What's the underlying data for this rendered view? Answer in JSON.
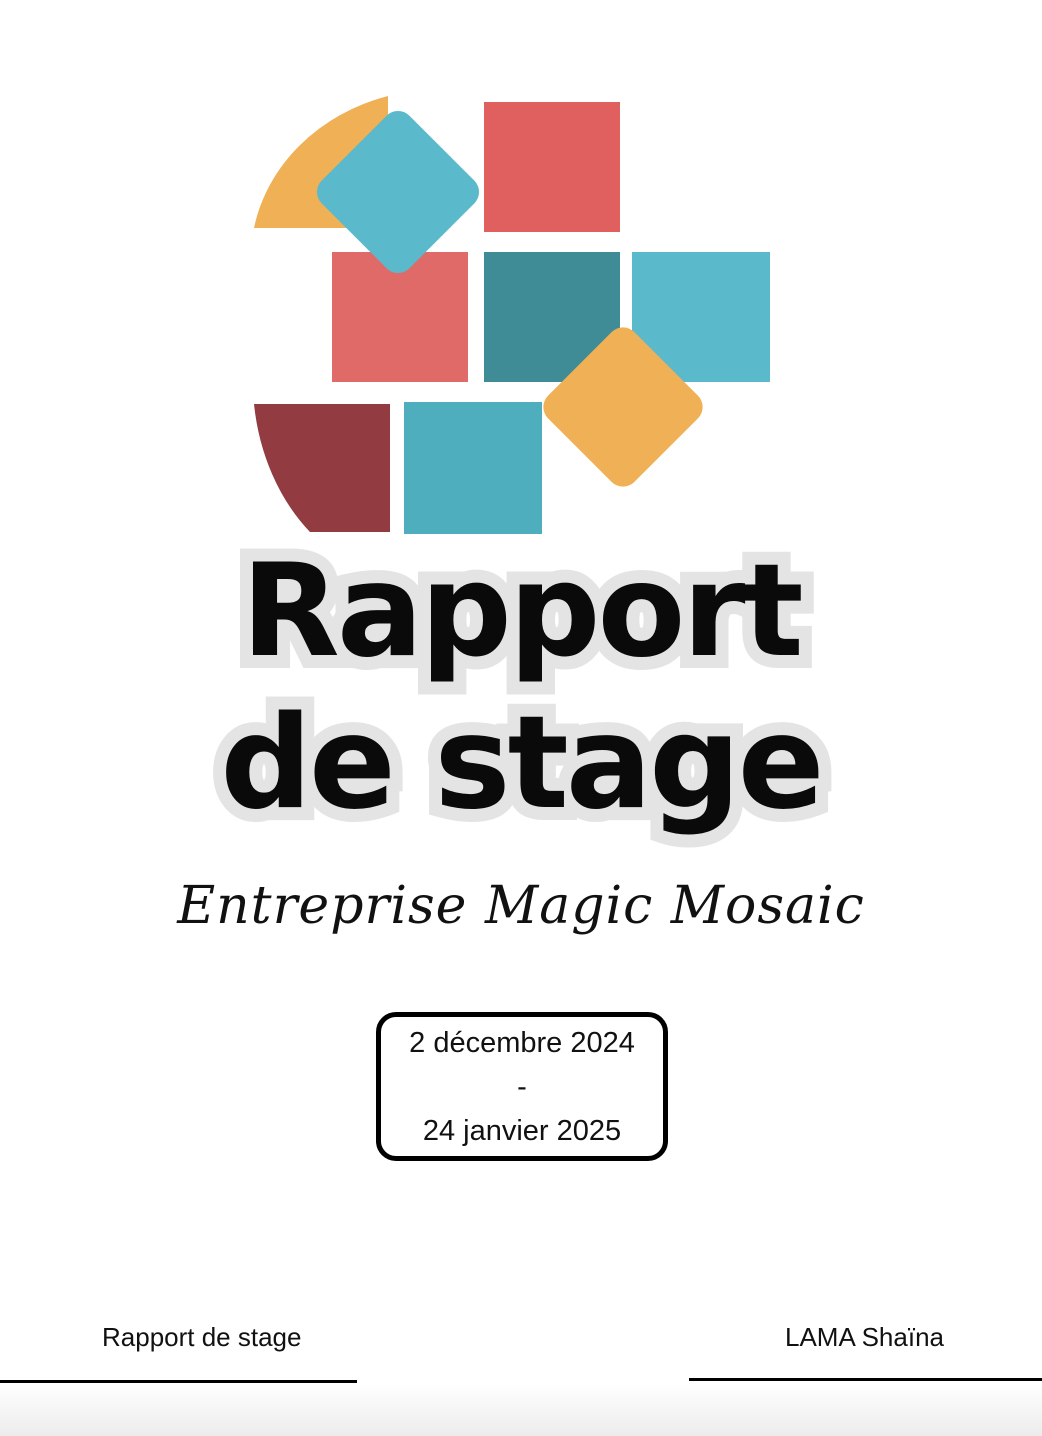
{
  "document": {
    "title_line1": "Rapport",
    "title_line2": "de stage",
    "subtitle": "Entreprise Magic Mosaic",
    "dates": {
      "start": "2 décembre 2024",
      "separator": "-",
      "end": "24 janvier 2025"
    },
    "footer": {
      "left": "Rapport de stage",
      "right": "LAMA Shaïna"
    }
  },
  "colors": {
    "coral": "#e0605f",
    "teal_light": "#5bb9cc",
    "teal_dark": "#3f8b96",
    "orange": "#f0b055",
    "maroon": "#923c42",
    "text": "#0a0a0a",
    "title_outline": "#e4e4e4"
  },
  "icons": {
    "logo": "mosaic-tiles-logo"
  }
}
